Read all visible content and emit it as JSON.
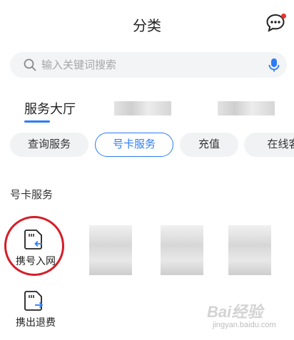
{
  "header": {
    "title": "分类"
  },
  "search": {
    "placeholder": "输入关键词搜索"
  },
  "top_tabs": {
    "active_label": "服务大厅"
  },
  "chips": [
    {
      "label": "查询服务",
      "active": false
    },
    {
      "label": "号卡服务",
      "active": true
    },
    {
      "label": "充值",
      "active": false
    },
    {
      "label": "在线客",
      "active": false
    }
  ],
  "section": {
    "title": "号卡服务",
    "items": [
      {
        "label": "携号入网",
        "icon": "sim-card-in-icon"
      },
      {
        "label": "携出退费",
        "icon": "sim-card-out-icon"
      }
    ]
  },
  "watermark": {
    "main": "Bai经验",
    "sub": "jingyan.baidu.com"
  },
  "colors": {
    "accent": "#2c7cf6",
    "highlight_ring": "#d41e28",
    "badge": "#e5322d"
  }
}
